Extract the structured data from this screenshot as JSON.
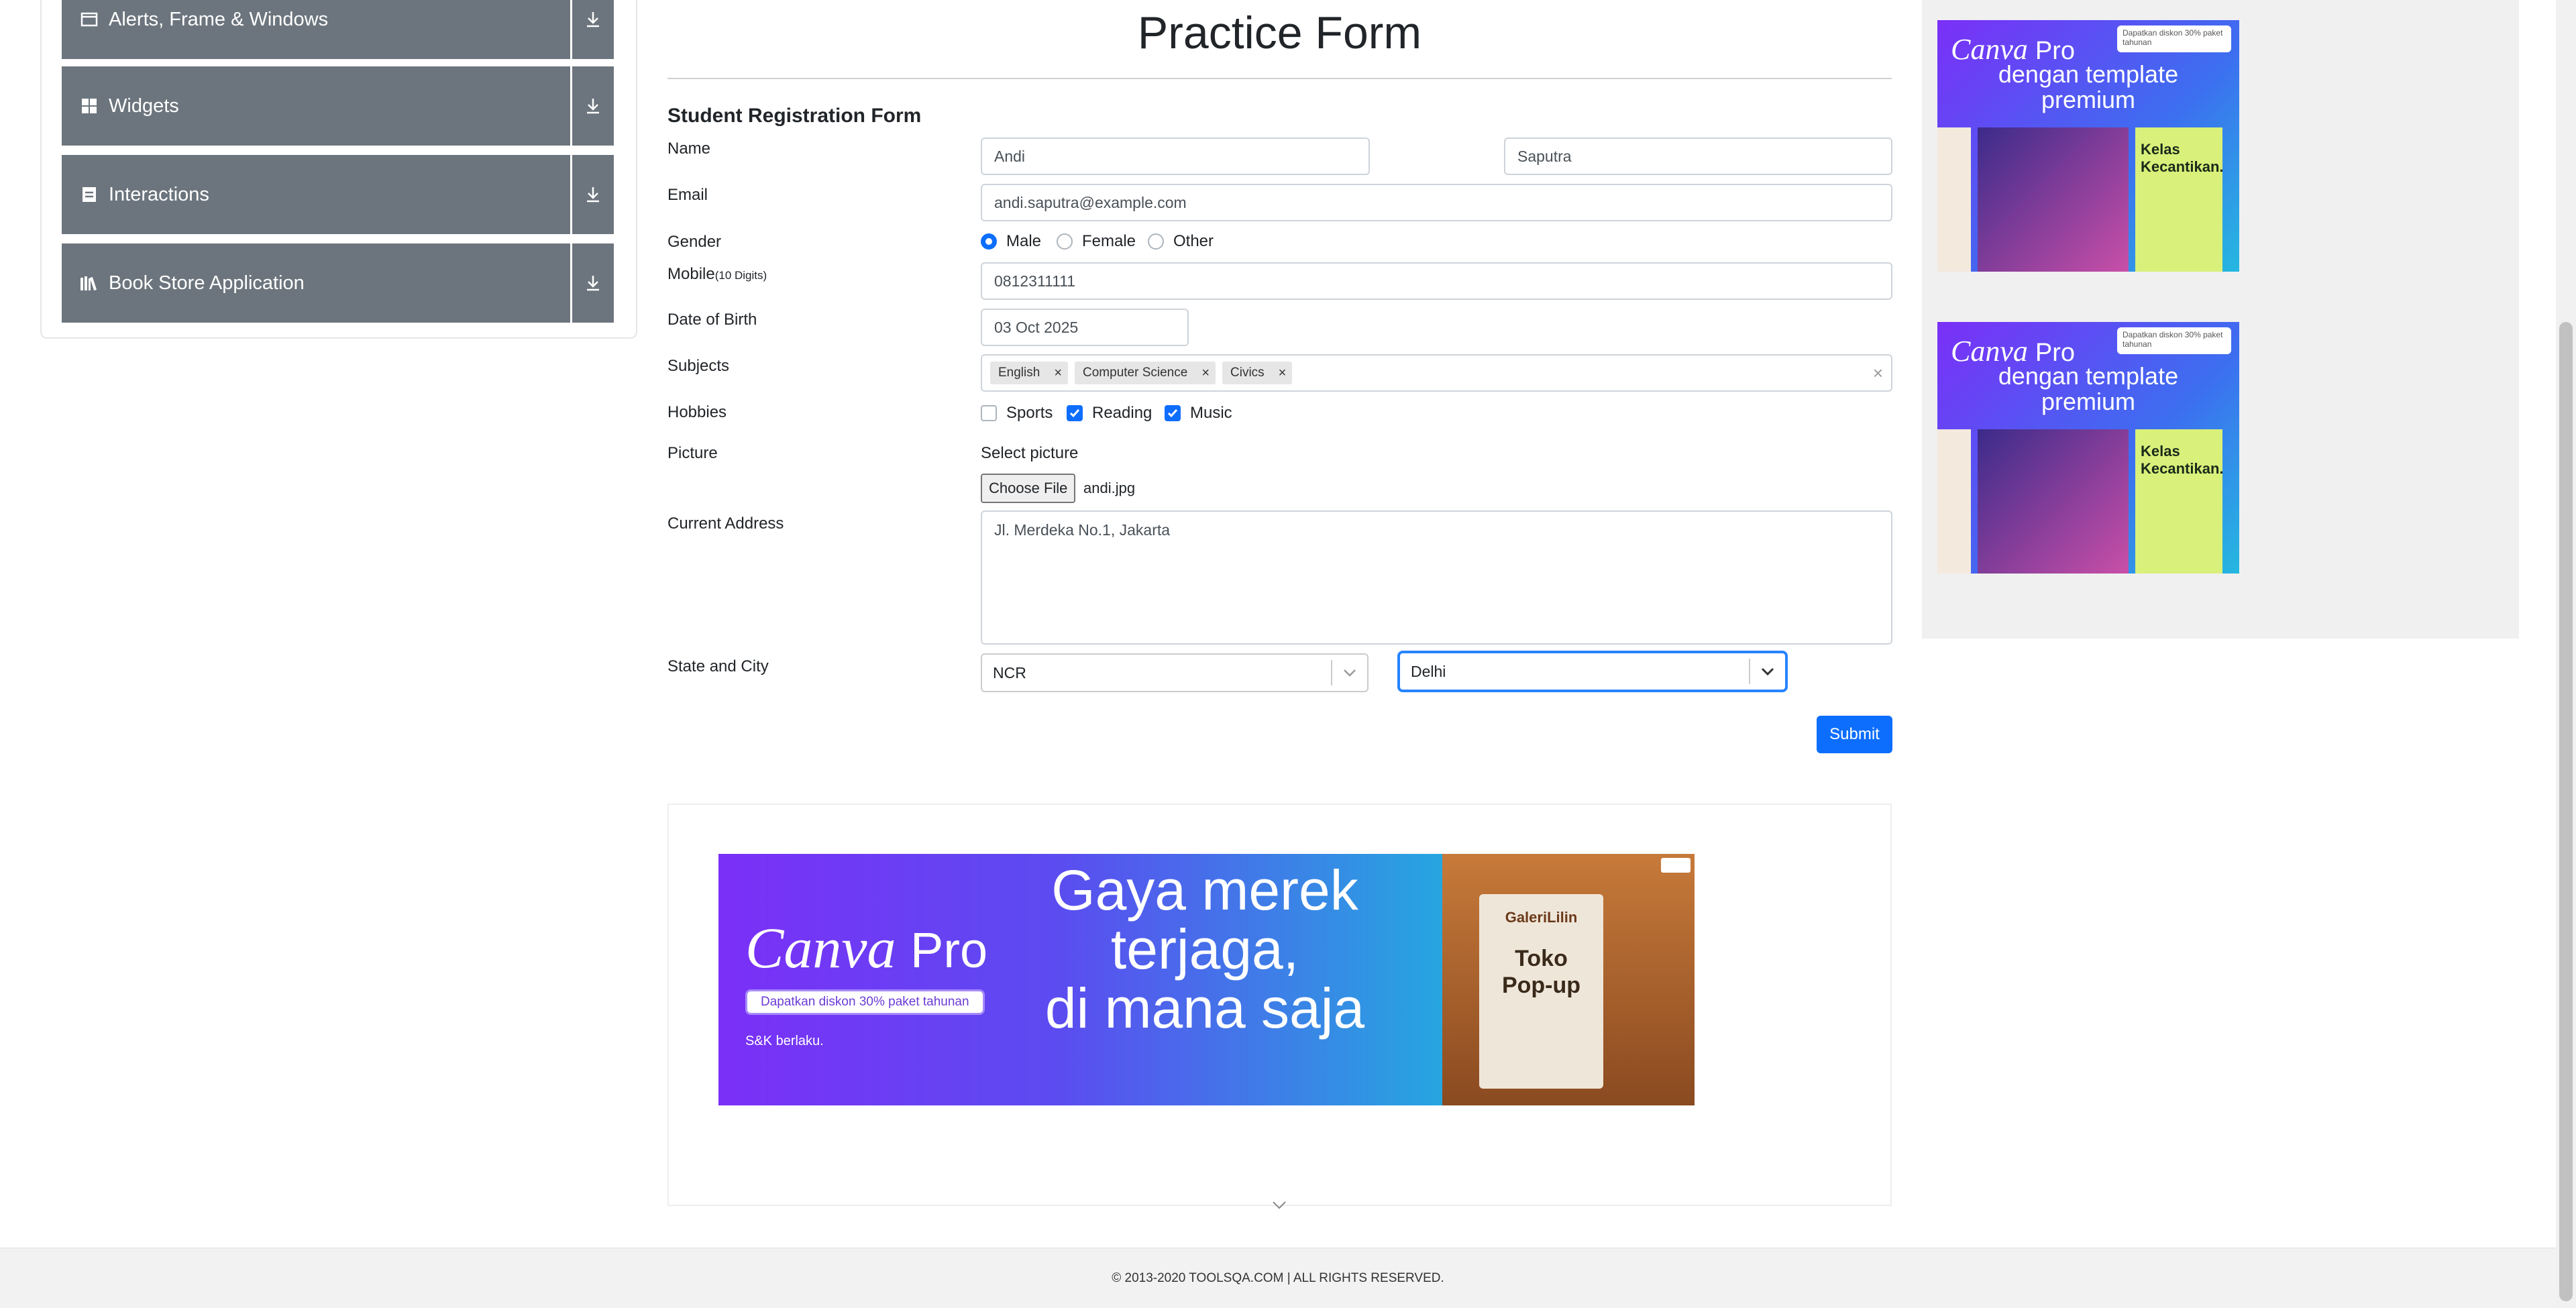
{
  "sidebar": {
    "groups": [
      {
        "label": "Alerts, Frame & Windows",
        "icon": "window-icon"
      },
      {
        "label": "Widgets",
        "icon": "grid-icon"
      },
      {
        "label": "Interactions",
        "icon": "interactions-icon"
      },
      {
        "label": "Book Store Application",
        "icon": "books-icon"
      }
    ]
  },
  "main": {
    "title": "Practice Form",
    "form_title": "Student Registration Form",
    "labels": {
      "name": "Name",
      "email": "Email",
      "gender": "Gender",
      "mobile": "Mobile",
      "mobile_hint": "(10 Digits)",
      "dob": "Date of Birth",
      "subjects": "Subjects",
      "hobbies": "Hobbies",
      "picture": "Picture",
      "address": "Current Address",
      "state_city": "State and City"
    },
    "values": {
      "first_name": "Andi",
      "last_name": "Saputra",
      "email": "andi.saputra@example.com",
      "mobile": "0812311111",
      "dob": "03 Oct 2025",
      "address": "Jl. Merdeka No.1, Jakarta",
      "state": "NCR",
      "city": "Delhi"
    },
    "gender_options": [
      {
        "label": "Male",
        "checked": true
      },
      {
        "label": "Female",
        "checked": false
      },
      {
        "label": "Other",
        "checked": false
      }
    ],
    "subjects": [
      "English",
      "Computer Science",
      "Civics"
    ],
    "hobbies": [
      {
        "label": "Sports",
        "checked": false
      },
      {
        "label": "Reading",
        "checked": true
      },
      {
        "label": "Music",
        "checked": true
      }
    ],
    "picture": {
      "select_label": "Select picture",
      "button": "Choose File",
      "filename": "andi.jpg"
    },
    "submit": "Submit"
  },
  "ads": {
    "banner": {
      "brand": "Canva",
      "brand_suffix": "Pro",
      "promo": "Dapatkan diskon 30% paket tahunan",
      "terms": "S&K berlaku.",
      "headline_1": "Gaya merek",
      "headline_2": "terjaga,",
      "headline_3": "di mana saja",
      "shop_name": "GaleriLilin",
      "card_1": "Toko",
      "card_2": "Pop-up"
    },
    "side": {
      "brand": "Canva",
      "brand_suffix": "Pro",
      "line_1": "dengan template",
      "line_2": "premium",
      "promo": "Dapatkan diskon 30% paket tahunan",
      "card": "Kelas Kecantikan."
    }
  },
  "footer": "© 2013-2020 TOOLSQA.COM | ALL RIGHTS RESERVED."
}
